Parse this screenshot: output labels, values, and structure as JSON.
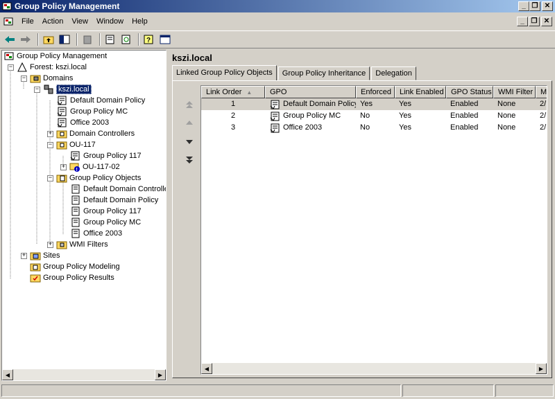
{
  "window": {
    "title": "Group Policy Management"
  },
  "menu": {
    "file": "File",
    "action": "Action",
    "view": "View",
    "window": "Window",
    "help": "Help"
  },
  "tree": {
    "root": "Group Policy Management",
    "forest": "Forest: kszi.local",
    "domains": "Domains",
    "domain": "kszi.local",
    "items": [
      "Default Domain Policy",
      "Group Policy MC",
      "Office 2003",
      "Domain Controllers",
      "OU-117",
      "Group Policy 117",
      "OU-117-02",
      "Group Policy Objects",
      "Default Domain Controlle",
      "Default Domain Policy",
      "Group Policy 117",
      "Group Policy MC",
      "Office 2003",
      "WMI Filters"
    ],
    "sites": "Sites",
    "modeling": "Group Policy Modeling",
    "results": "Group Policy Results"
  },
  "details": {
    "title": "kszi.local",
    "tabs": [
      "Linked Group Policy Objects",
      "Group Policy Inheritance",
      "Delegation"
    ],
    "columns": [
      "Link Order",
      "GPO",
      "Enforced",
      "Link Enabled",
      "GPO Status",
      "WMI Filter",
      "M"
    ],
    "rows": [
      {
        "order": "1",
        "gpo": "Default Domain Policy",
        "enforced": "Yes",
        "link_enabled": "Yes",
        "status": "Enabled",
        "wmi": "None",
        "m": "2/"
      },
      {
        "order": "2",
        "gpo": "Group Policy MC",
        "enforced": "No",
        "link_enabled": "Yes",
        "status": "Enabled",
        "wmi": "None",
        "m": "2/"
      },
      {
        "order": "3",
        "gpo": "Office 2003",
        "enforced": "No",
        "link_enabled": "Yes",
        "status": "Enabled",
        "wmi": "None",
        "m": "2/"
      }
    ]
  }
}
